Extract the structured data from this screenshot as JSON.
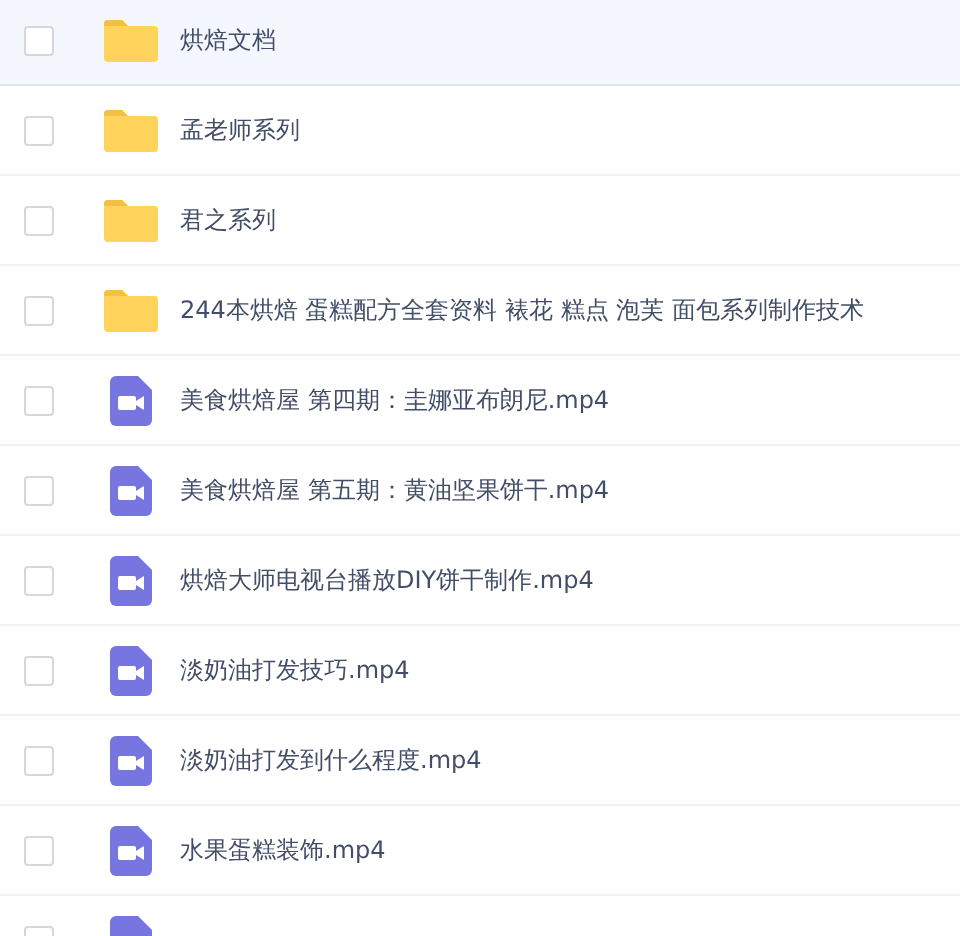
{
  "files": [
    {
      "kind": "folder",
      "name": "烘焙文档",
      "checked": false,
      "highlighted": true
    },
    {
      "kind": "folder",
      "name": "孟老师系列",
      "checked": false,
      "highlighted": false
    },
    {
      "kind": "folder",
      "name": "君之系列",
      "checked": false,
      "highlighted": false
    },
    {
      "kind": "folder",
      "name": "244本烘焙 蛋糕配方全套资料 裱花 糕点 泡芙 面包系列制作技术",
      "checked": false,
      "highlighted": false
    },
    {
      "kind": "video",
      "name": "美食烘焙屋 第四期：圭娜亚布朗尼.mp4",
      "checked": false,
      "highlighted": false
    },
    {
      "kind": "video",
      "name": "美食烘焙屋 第五期：黄油坚果饼干.mp4",
      "checked": false,
      "highlighted": false
    },
    {
      "kind": "video",
      "name": "烘焙大师电视台播放DIY饼干制作.mp4",
      "checked": false,
      "highlighted": false
    },
    {
      "kind": "video",
      "name": "淡奶油打发技巧.mp4",
      "checked": false,
      "highlighted": false
    },
    {
      "kind": "video",
      "name": "淡奶油打发到什么程度.mp4",
      "checked": false,
      "highlighted": false
    },
    {
      "kind": "video",
      "name": "水果蛋糕装饰.mp4",
      "checked": false,
      "highlighted": false
    },
    {
      "kind": "video",
      "checked": false
    }
  ]
}
